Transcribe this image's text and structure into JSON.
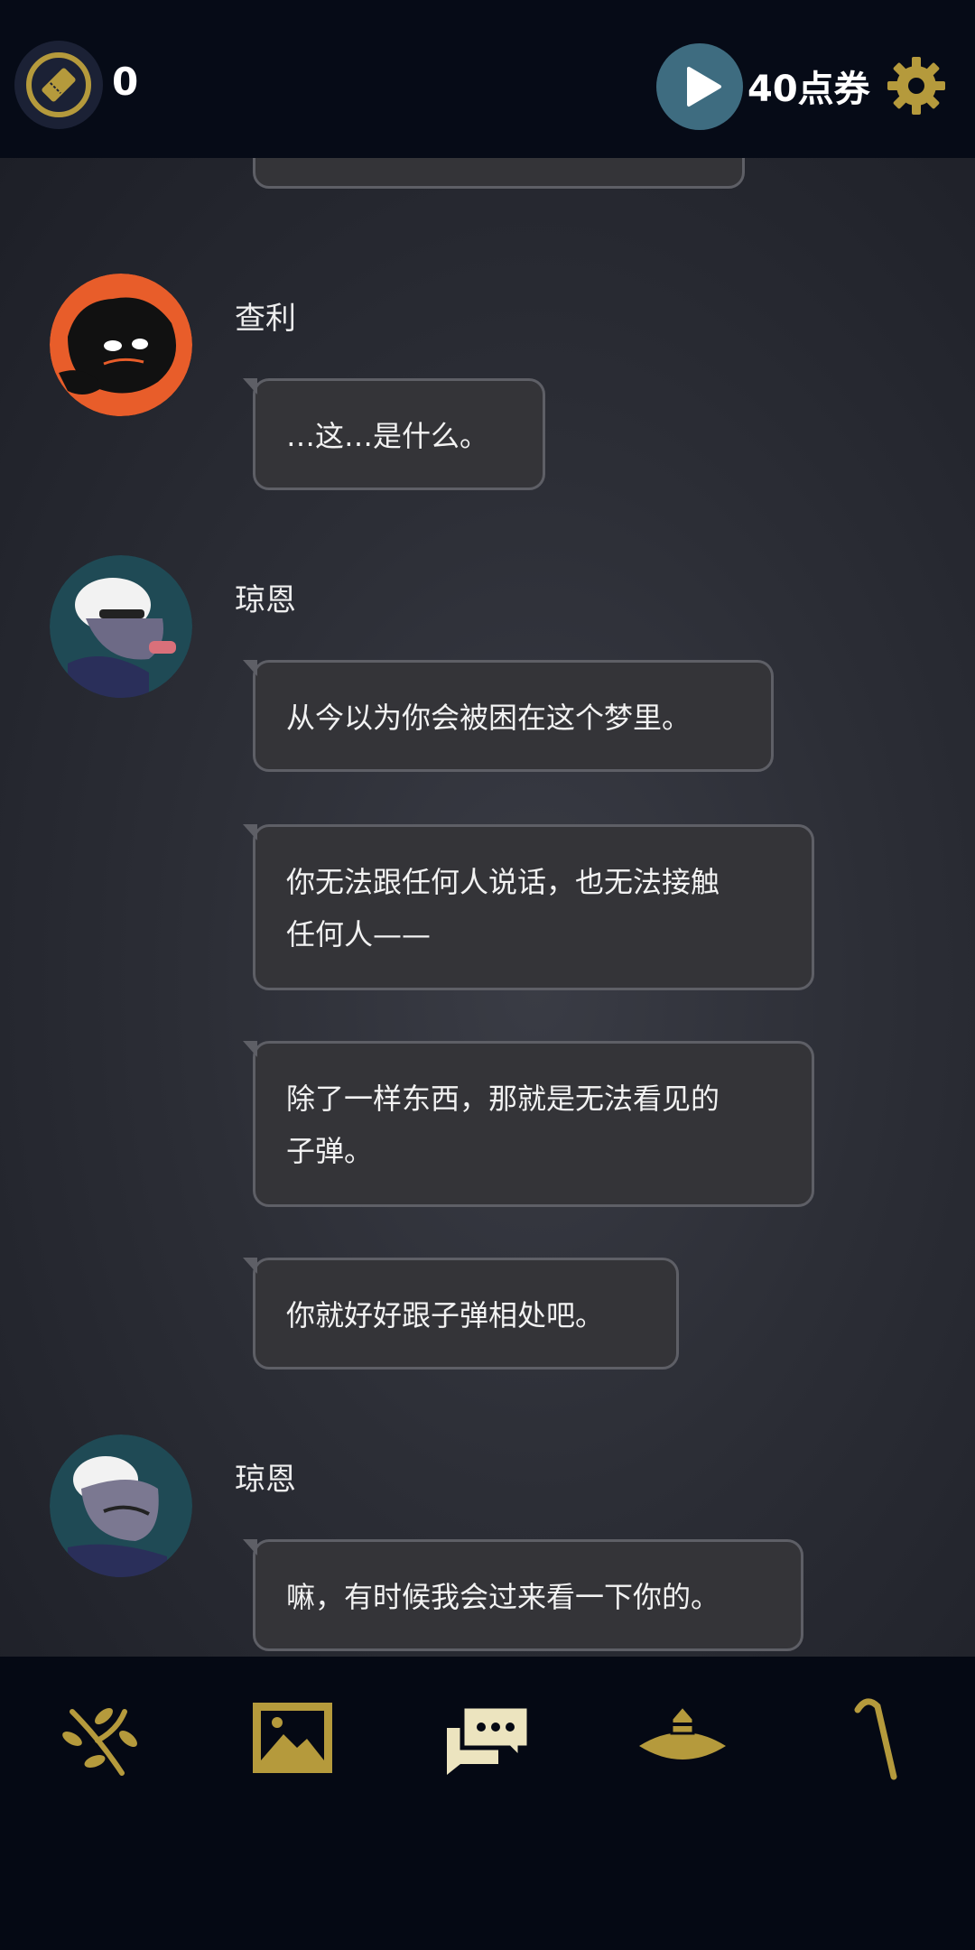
{
  "header": {
    "ticket_count": "0",
    "coupon_label": "40点券",
    "icons": {
      "ticket": "ticket-icon",
      "play": "play-icon",
      "settings": "gear-icon"
    }
  },
  "messages": [
    {
      "speaker": "查利",
      "lines": [
        "…这…是什么。"
      ]
    },
    {
      "speaker": "琼恩",
      "lines": [
        "从今以为你会被困在这个梦里。",
        "你无法跟任何人说话，也无法接触任何人——",
        "除了一样东西，那就是无法看见的子弹。",
        "你就好好跟子弹相处吧。"
      ]
    },
    {
      "speaker": "琼恩",
      "lines": [
        "嘛，有时候我会过来看一下你的。"
      ]
    }
  ],
  "bubbles": {
    "m1": "…这…是什么。",
    "m2": "从今以为你会被困在这个梦里。",
    "m3a": "你无法跟任何人说话，也无法接触",
    "m3b": "任何人——",
    "m4a": "除了一样东西，那就是无法看见的",
    "m4b": "子弹。",
    "m5": "你就好好跟子弹相处吧。",
    "m6": "嘛，有时候我会过来看一下你的。"
  },
  "speakers": {
    "charlie": "查利",
    "jon1": "琼恩",
    "jon2": "琼恩"
  },
  "bottom_nav": [
    {
      "icon": "branch-icon"
    },
    {
      "icon": "gallery-icon"
    },
    {
      "icon": "chat-icon",
      "active": true
    },
    {
      "icon": "hat-icon"
    },
    {
      "icon": "cane-icon"
    }
  ],
  "colors": {
    "accent_gold": "#b59a3c",
    "play_button": "#3e6c80",
    "bubble_bg": "#343438",
    "bubble_border": "#5e5f66"
  }
}
